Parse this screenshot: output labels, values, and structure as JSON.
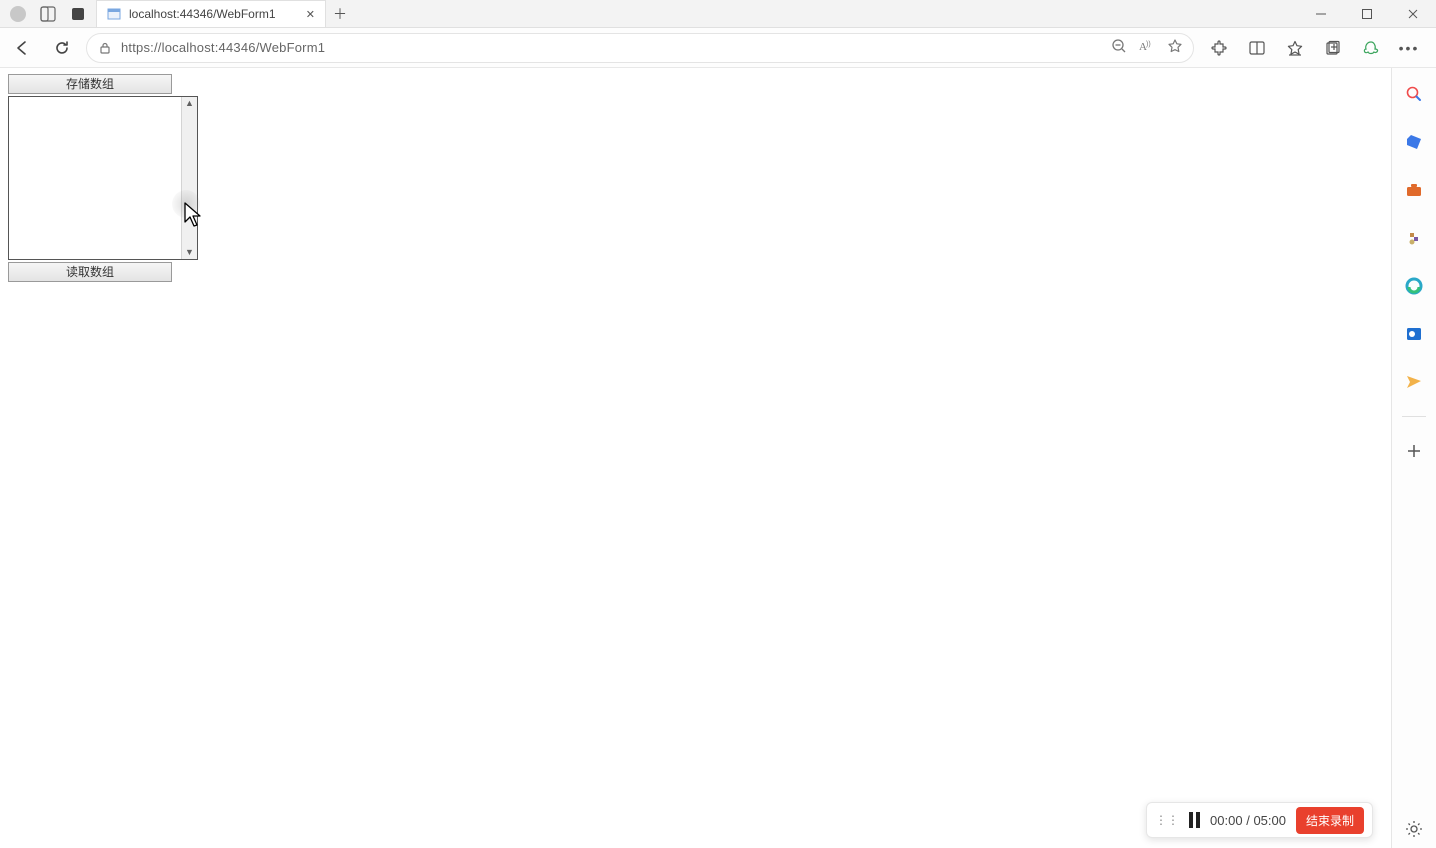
{
  "browser": {
    "tab_title": "localhost:44346/WebForm1",
    "url": "https://localhost:44346/WebForm1"
  },
  "page": {
    "button_save": "存储数组",
    "button_load": "读取数组"
  },
  "sidebar": {
    "items": [
      "search-icon",
      "shopping-icon",
      "toolbox-icon",
      "games-icon",
      "edge-icon",
      "outlook-icon",
      "send-icon"
    ]
  },
  "recorder": {
    "elapsed": "00:00",
    "separator": "/",
    "total": "05:00",
    "stop_label": "结束录制"
  }
}
